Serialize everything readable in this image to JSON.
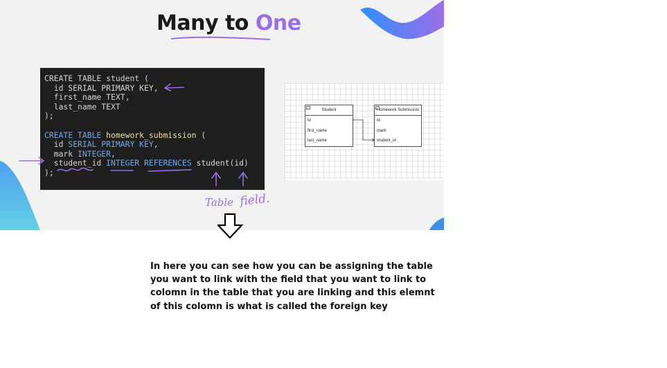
{
  "slide": {
    "title_main": "Many to ",
    "title_accent": "One",
    "accent_color": "#9b6ee6"
  },
  "code_lines": [
    [
      {
        "t": "CREATE TABLE student ("
      }
    ],
    [
      {
        "t": "  id SERIAL PRIMARY KEY,"
      }
    ],
    [
      {
        "t": "  first_name TEXT,"
      }
    ],
    [
      {
        "t": "  last_name TEXT"
      }
    ],
    [
      {
        "t": ");"
      }
    ],
    [
      {
        "t": ""
      }
    ],
    [
      {
        "t": "CREATE TABLE ",
        "c": "kw"
      },
      {
        "t": "homework_submission",
        "c": "tn"
      },
      {
        "t": " ("
      }
    ],
    [
      {
        "t": "  id "
      },
      {
        "t": "SERIAL PRIMARY KEY",
        "c": "kw"
      },
      {
        "t": ","
      }
    ],
    [
      {
        "t": "  mark "
      },
      {
        "t": "INTEGER",
        "c": "kw"
      },
      {
        "t": ","
      }
    ],
    [
      {
        "t": "  student_id "
      },
      {
        "t": "INTEGER REFERENCES",
        "c": "kw"
      },
      {
        "t": " student(id)"
      }
    ],
    [
      {
        "t": ");"
      }
    ]
  ],
  "diagram": {
    "student": {
      "title": "Student",
      "fields": [
        "id",
        "first_name",
        "last_name"
      ]
    },
    "homework": {
      "title": "Homework Submission",
      "fields": [
        "id",
        "mark",
        "student_id"
      ]
    }
  },
  "handwriting": {
    "table_label": "Table",
    "field_label": "field."
  },
  "icons": {
    "down_arrow": "down-arrow-icon"
  },
  "note": "In here you can see how you can be assigning the table you want to link with the field that you want to link to colomn in the table that you are linking and this elemnt of this colomn is what is called the foreign key"
}
